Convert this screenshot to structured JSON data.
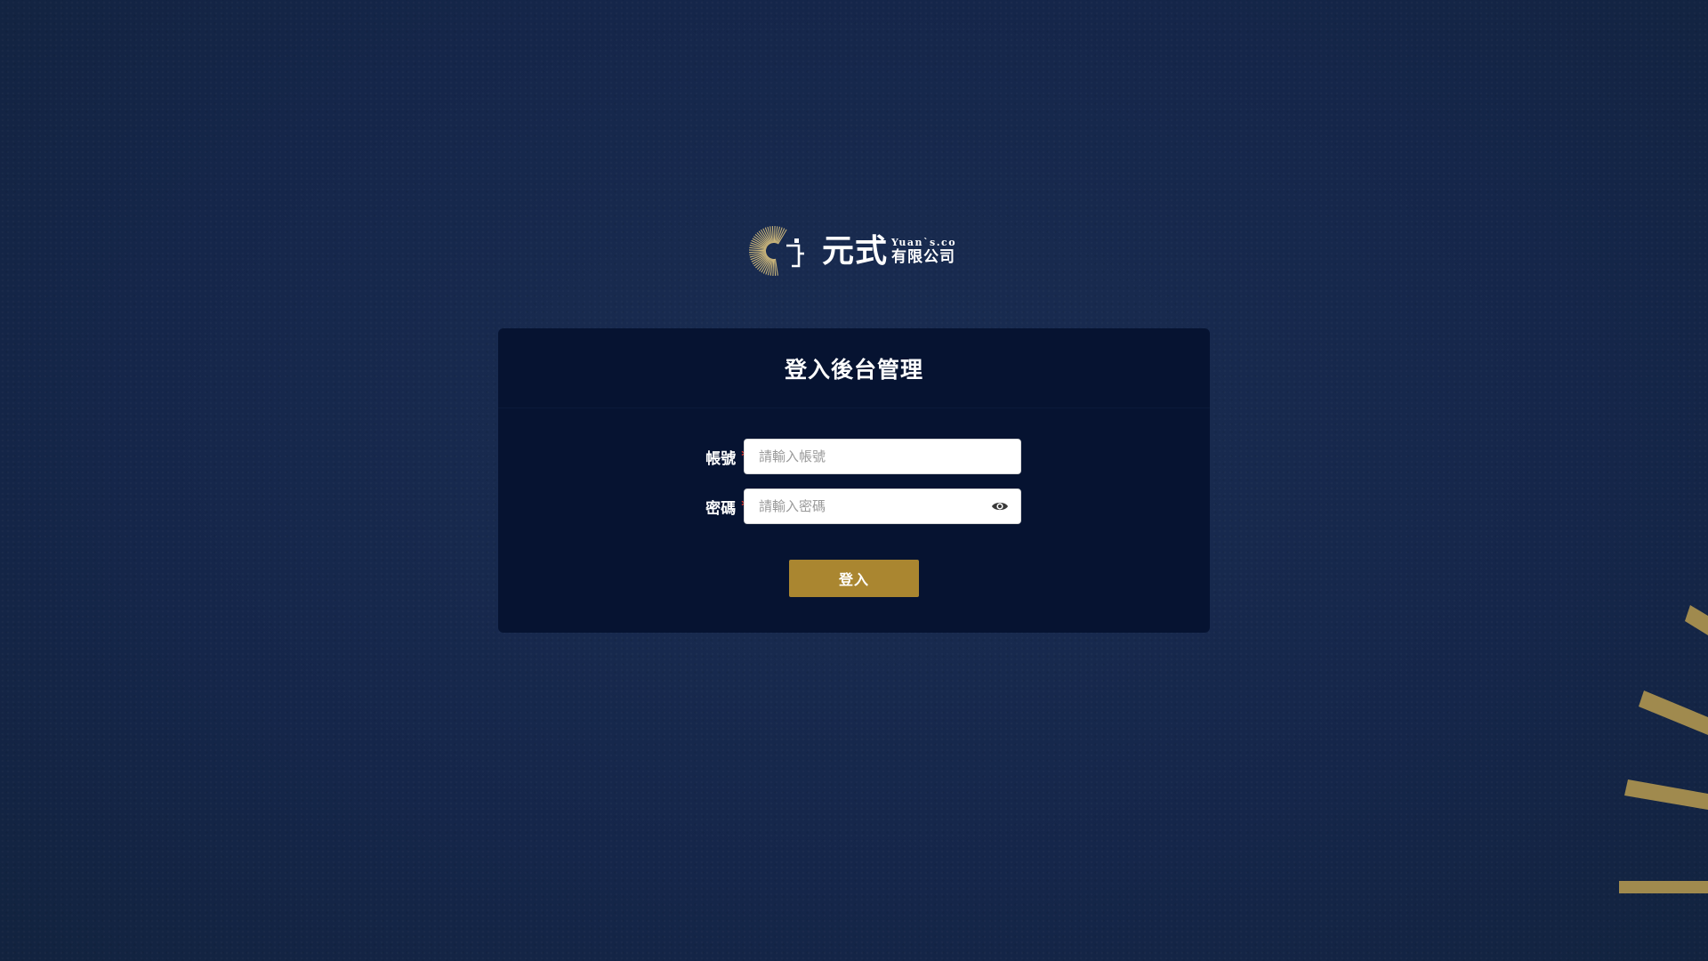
{
  "brand": {
    "name_cn": "元式",
    "name_en": "Yuan`s.co",
    "subtitle": "有限公司"
  },
  "login": {
    "title": "登入後台管理",
    "account": {
      "label": "帳號",
      "required_mark": "*",
      "placeholder": "請輸入帳號",
      "value": ""
    },
    "password": {
      "label": "密碼",
      "required_mark": "*",
      "placeholder": "請輸入密碼",
      "value": "",
      "toggle_icon": "eye-icon"
    },
    "submit_label": "登入"
  },
  "colors": {
    "background": "#16284b",
    "card": "#061331",
    "accent_gold": "#aa8630",
    "required": "#e0392f"
  }
}
